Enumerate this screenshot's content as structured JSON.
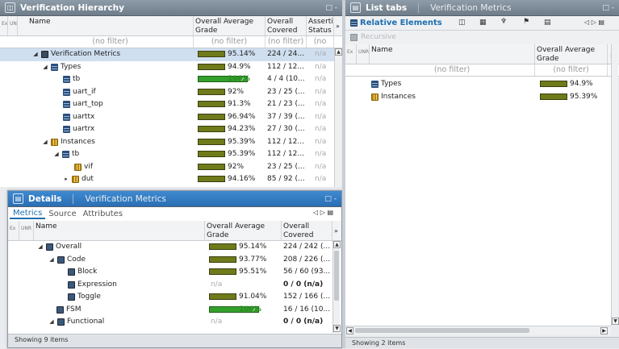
{
  "hierarchy": {
    "title": "Verification Hierarchy",
    "columns": {
      "ex": "Ex",
      "unr": "UNR",
      "name": "Name",
      "grade": "Overall Average Grade",
      "covered": "Overall Covered",
      "assert": "Assertion Status"
    },
    "filter": {
      "name": "(no filter)",
      "grade": "(no filter)",
      "covered": "(no filter)",
      "assert": "(no"
    },
    "rows": [
      {
        "name": "Verification Metrics",
        "pct": "95.14%",
        "covered": "224 / 24...",
        "assert": "n/a"
      },
      {
        "name": "Types",
        "pct": "94.9%",
        "covered": "112 / 12...",
        "assert": "n/a"
      },
      {
        "name": "tb",
        "pct": "100%",
        "covered": "4 / 4 (10...",
        "assert": "n/a"
      },
      {
        "name": "uart_if",
        "pct": "92%",
        "covered": "23 / 25 (...",
        "assert": "n/a"
      },
      {
        "name": "uart_top",
        "pct": "91.3%",
        "covered": "21 / 23 (...",
        "assert": "n/a"
      },
      {
        "name": "uarttx",
        "pct": "96.94%",
        "covered": "37 / 39 (...",
        "assert": "n/a"
      },
      {
        "name": "uartrx",
        "pct": "94.23%",
        "covered": "27 / 30 (...",
        "assert": "n/a"
      },
      {
        "name": "Instances",
        "pct": "95.39%",
        "covered": "112 / 12...",
        "assert": "n/a"
      },
      {
        "name": "tb",
        "pct": "95.39%",
        "covered": "112 / 12...",
        "assert": "n/a"
      },
      {
        "name": "vif",
        "pct": "92%",
        "covered": "23 / 25 (...",
        "assert": "n/a"
      },
      {
        "name": "dut",
        "pct": "94.16%",
        "covered": "85 / 92 (...",
        "assert": "n/a"
      }
    ]
  },
  "details": {
    "title": "Details",
    "subtitle": "Verification Metrics",
    "tabs": [
      "Metrics",
      "Source",
      "Attributes"
    ],
    "columns": {
      "ex": "Ex",
      "unr": "UNR",
      "name": "Name",
      "grade": "Overall Average Grade",
      "covered": "Overall Covered"
    },
    "rows": [
      {
        "name": "Overall",
        "pct": "95.14%",
        "covered": "224 / 242 (..."
      },
      {
        "name": "Code",
        "pct": "93.77%",
        "covered": "208 / 226 (..."
      },
      {
        "name": "Block",
        "pct": "95.51%",
        "covered": "56 / 60 (93..."
      },
      {
        "name": "Expression",
        "pct": "n/a",
        "covered": "0 / 0 (n/a)"
      },
      {
        "name": "Toggle",
        "pct": "91.04%",
        "covered": "152 / 166 (..."
      },
      {
        "name": "FSM",
        "pct": "100%",
        "covered": "16 / 16 (10..."
      },
      {
        "name": "Functional",
        "pct": "n/a",
        "covered": "0 / 0 (n/a)"
      }
    ],
    "status": "Showing 9 items"
  },
  "list": {
    "title": "List tabs",
    "subtitle": "Verification Metrics",
    "tab": "Relative Elements",
    "recursive": "Recursive",
    "columns": {
      "ex": "Ex",
      "unr": "UNR",
      "name": "Name",
      "grade": "Overall Average Grade"
    },
    "filter": {
      "name": "(no filter)",
      "grade": "(no filter)"
    },
    "rows": [
      {
        "name": "Types",
        "pct": "94.9%"
      },
      {
        "name": "Instances",
        "pct": "95.39%"
      }
    ],
    "status": "Showing 2 items"
  },
  "window_ctrl": "□ - ",
  "nav_ctrl": "◁ ▷ ▤"
}
